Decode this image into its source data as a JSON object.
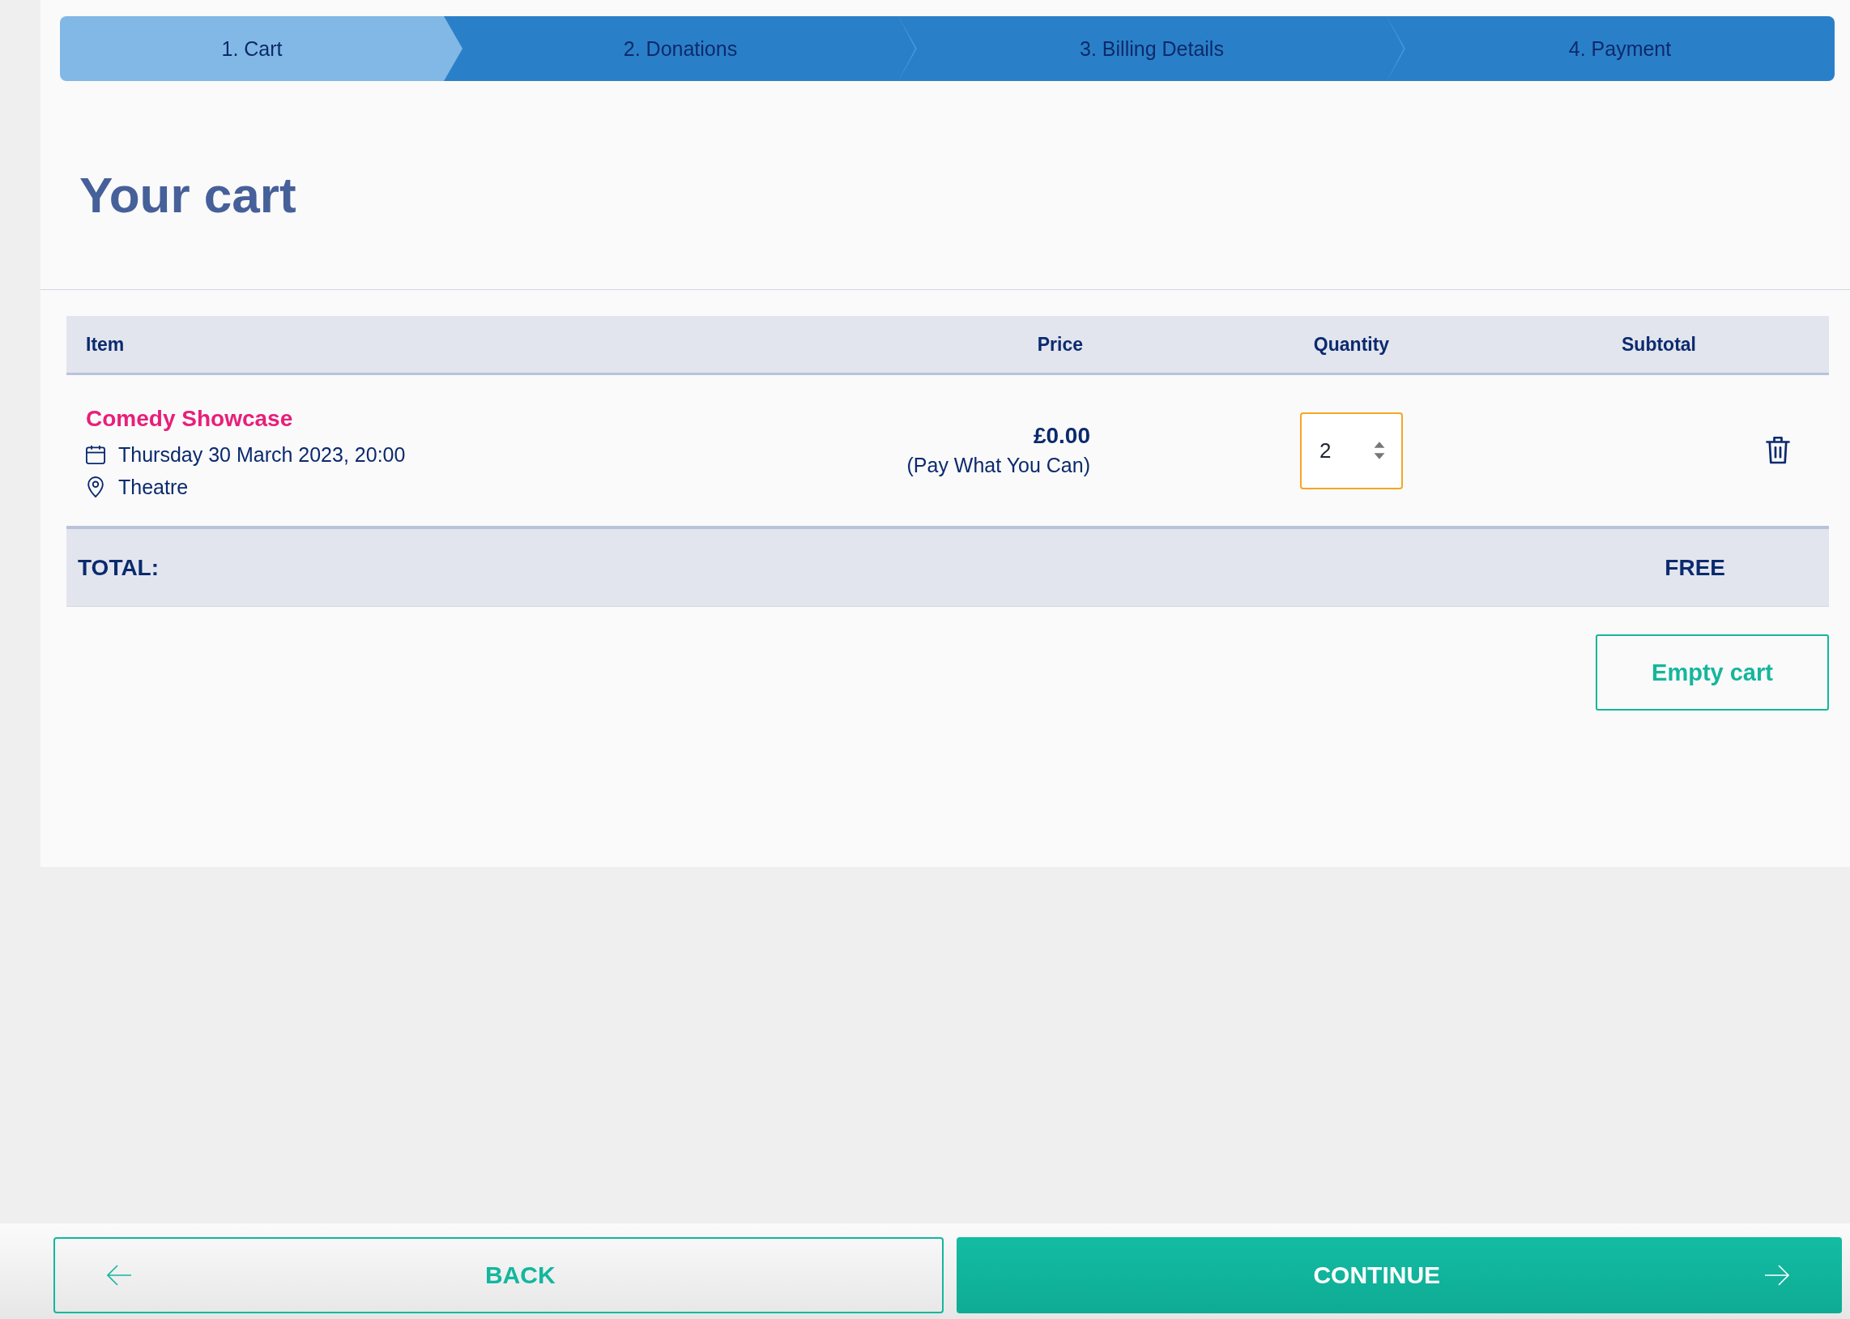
{
  "checkout_steps": [
    {
      "label": "1. Cart",
      "selected": true
    },
    {
      "label": "2. Donations",
      "selected": false
    },
    {
      "label": "3. Billing Details",
      "selected": false
    },
    {
      "label": "4. Payment",
      "selected": false
    }
  ],
  "title": "Your cart",
  "cart_table": {
    "columns": [
      "Item",
      "Price",
      "Quantity",
      "Subtotal"
    ],
    "rows": [
      {
        "event": "Comedy Showcase",
        "date": "Thursday 30 March 2023, 20:00",
        "venue": "Theatre",
        "price": "£0.00",
        "price_note": "(Pay What You Can)",
        "quantity": "2",
        "focused": true
      }
    ],
    "total": {
      "label": "TOTAL:",
      "value": "FREE"
    }
  },
  "empty_cart_button": {
    "label": "Empty cart"
  },
  "footer": {
    "back_button": {
      "label": "BACK"
    },
    "continue_button": {
      "label": "CONTINUE"
    }
  }
}
